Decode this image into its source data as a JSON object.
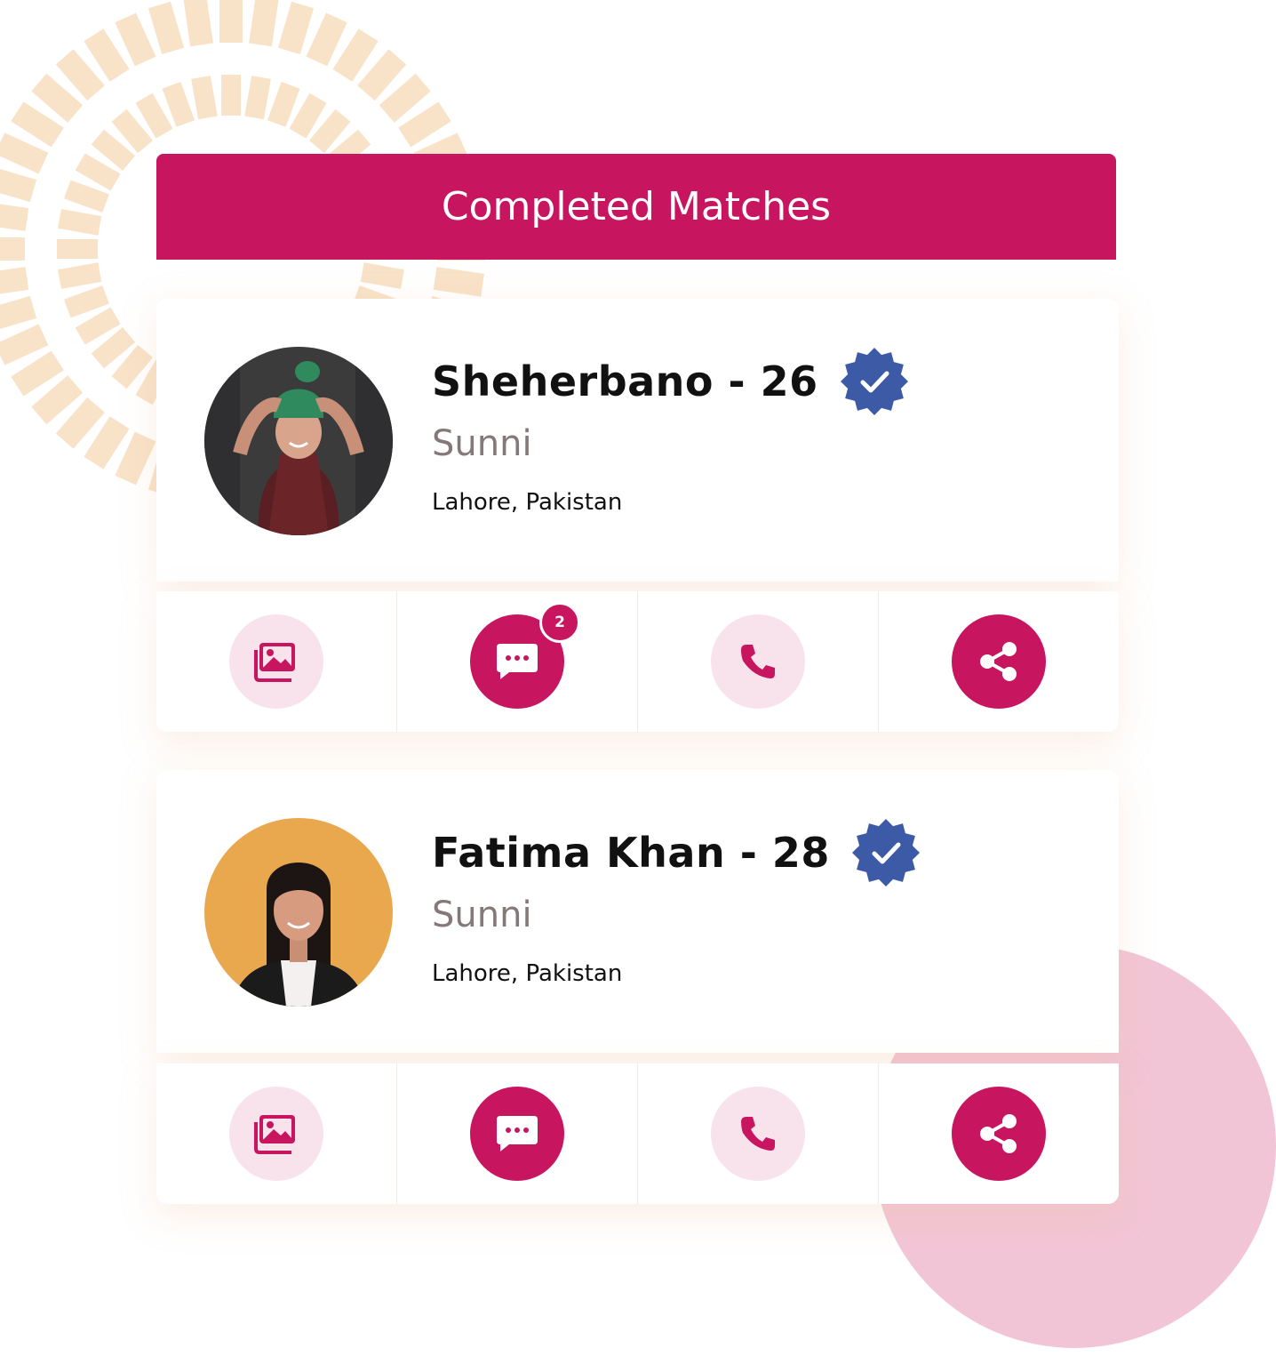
{
  "header": {
    "title": "Completed Matches"
  },
  "matches": [
    {
      "name_age": "Sheherbano - 26",
      "sect": "Sunni",
      "location": "Lahore, Pakistan",
      "message_badge_count": "2"
    },
    {
      "name_age": "Fatima Khan - 28",
      "sect": "Sunni",
      "location": "Lahore, Pakistan"
    }
  ],
  "colors": {
    "brand": "#c8155f",
    "brand_light": "#f8e3ec",
    "verified": "#3d5aa6",
    "decor_peach": "#f8e2c8",
    "decor_pink": "#f2c5d6"
  },
  "icons": [
    "gallery-icon",
    "chat-icon",
    "phone-icon",
    "share-icon",
    "verified-badge-icon"
  ]
}
